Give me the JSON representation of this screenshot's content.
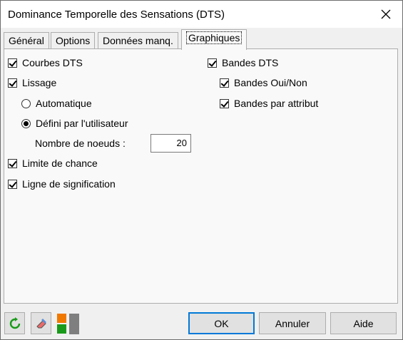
{
  "window": {
    "title": "Dominance Temporelle des Sensations (DTS)"
  },
  "tabs": [
    {
      "label": "Général",
      "active": false
    },
    {
      "label": "Options",
      "active": false
    },
    {
      "label": "Données manq.",
      "active": false
    },
    {
      "label": "Graphiques",
      "active": true
    }
  ],
  "left": {
    "courbes_dts": {
      "label": "Courbes DTS",
      "checked": true
    },
    "lissage": {
      "label": "Lissage",
      "checked": true
    },
    "automatique": {
      "label": "Automatique",
      "selected": false
    },
    "defini": {
      "label": "Défini par l'utilisateur",
      "selected": true
    },
    "nombre_noeuds": {
      "label": "Nombre de noeuds :",
      "value": "20"
    },
    "limite_chance": {
      "label": "Limite de chance",
      "checked": true
    },
    "ligne_signification": {
      "label": "Ligne de signification",
      "checked": true
    }
  },
  "right": {
    "bandes_dts": {
      "label": "Bandes DTS",
      "checked": true
    },
    "bandes_oui_non": {
      "label": "Bandes Oui/Non",
      "checked": true
    },
    "bandes_attribut": {
      "label": "Bandes par attribut",
      "checked": true
    }
  },
  "footer": {
    "ok": "OK",
    "annuler": "Annuler",
    "aide": "Aide",
    "icons": [
      "reset-icon",
      "eraser-icon",
      "toggle-options-icon"
    ]
  },
  "colors": {
    "green": "#1a9a1a",
    "orange": "#f07800",
    "accent": "#0078d7"
  }
}
